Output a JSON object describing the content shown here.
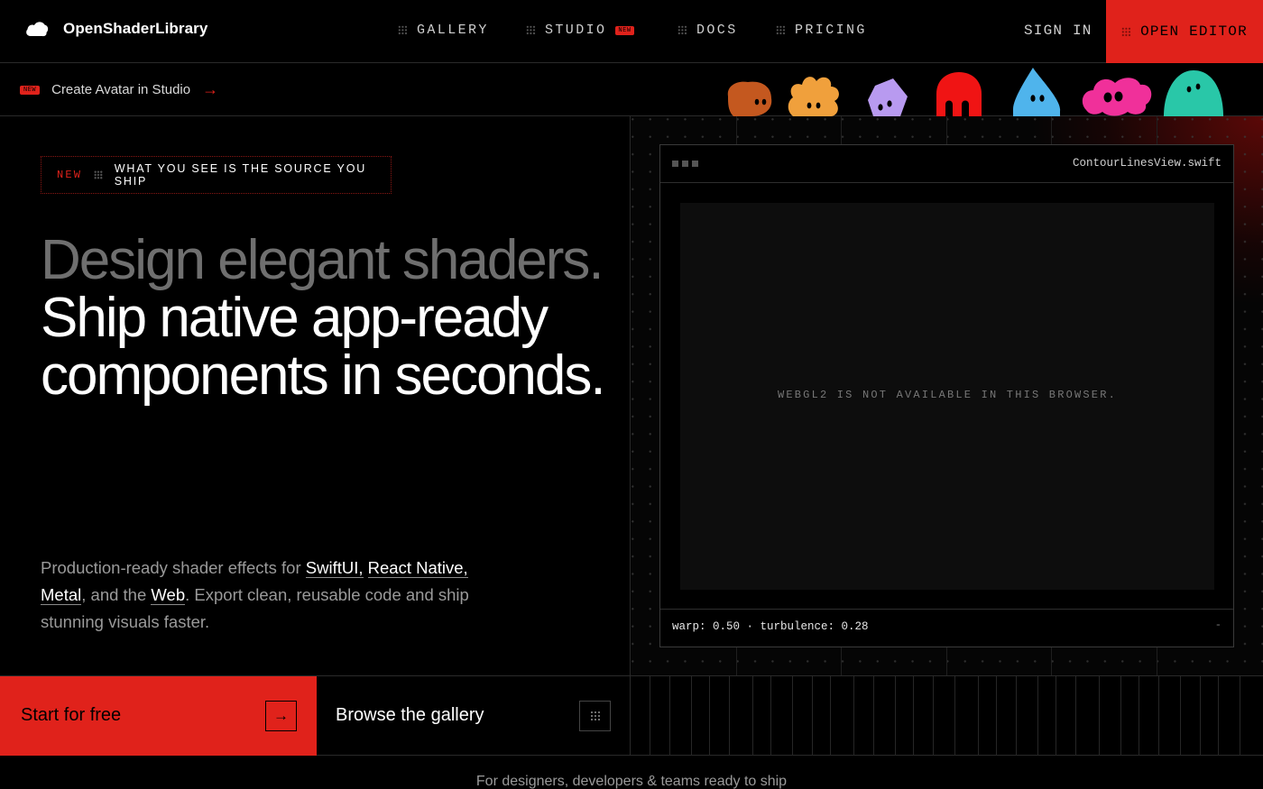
{
  "brand": {
    "name": "OpenShaderLibrary",
    "logo_icon": "cloud-logo-icon"
  },
  "nav": {
    "links": [
      {
        "label": "GALLERY"
      },
      {
        "label": "STUDIO",
        "badge": "NEW"
      },
      {
        "label": "DOCS"
      },
      {
        "label": "PRICING"
      }
    ],
    "sign_in": "SIGN IN",
    "open_editor": "OPEN EDITOR"
  },
  "announcement": {
    "badge": "NEW",
    "text": "Create Avatar in Studio",
    "arrow": "→"
  },
  "avatars": [
    {
      "name": "blob",
      "color": "#c4581f"
    },
    {
      "name": "flower",
      "color": "#f0a03c"
    },
    {
      "name": "cube",
      "color": "#b89af0"
    },
    {
      "name": "ghost",
      "color": "#f01414"
    },
    {
      "name": "drop",
      "color": "#4fb4ec"
    },
    {
      "name": "cloud",
      "color": "#f0309a"
    },
    {
      "name": "dome",
      "color": "#29c7a8"
    }
  ],
  "hero": {
    "tagline_badge": "NEW",
    "tagline_text": "WHAT YOU SEE IS THE SOURCE YOU SHIP",
    "headline_muted": "Design elegant shaders.",
    "headline_main": "Ship native app-ready components in seconds.",
    "subtitle": {
      "prefix": "Production-ready shader effects for ",
      "swiftui": "SwiftUI,",
      "react_native": "React Native,",
      "metal": "Metal",
      "middle": ", and the ",
      "web": "Web",
      "suffix": ". Export clean, reusable code and ship stunning visuals faster."
    }
  },
  "code_window": {
    "filename": "ContourLinesView.swift",
    "canvas_message": "WEBGL2 IS NOT AVAILABLE IN THIS BROWSER.",
    "params": "warp: 0.50 · turbulence: 0.28",
    "minimize": "-"
  },
  "cta": {
    "primary": "Start for free",
    "primary_arrow": "→",
    "secondary": "Browse the gallery"
  },
  "audience": "For designers, developers & teams ready to ship",
  "colors": {
    "accent": "#e0221b",
    "background": "#000000",
    "muted_text": "#6f6f6f"
  }
}
